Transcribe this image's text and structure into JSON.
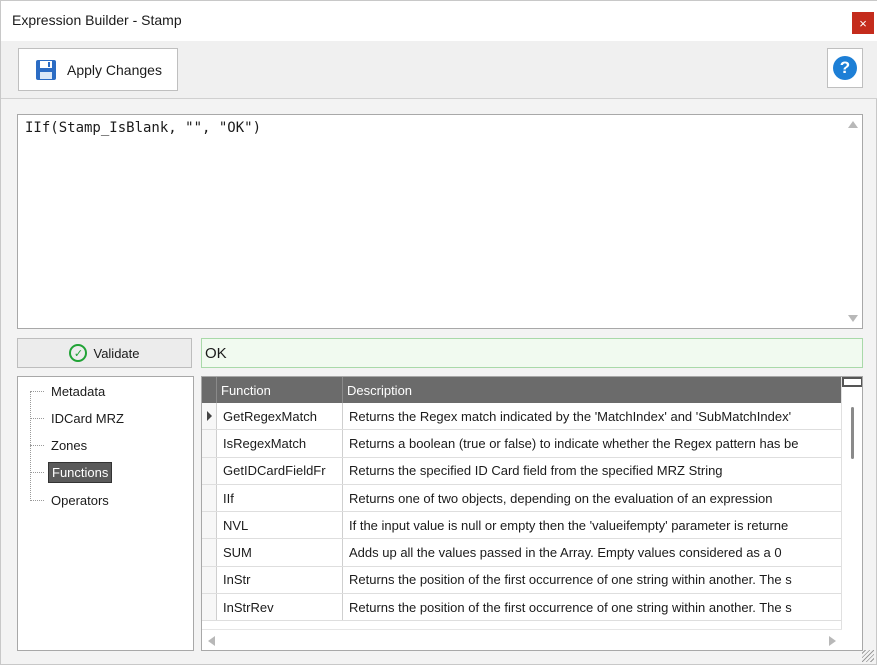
{
  "window": {
    "title": "Expression Builder - Stamp",
    "close_glyph": "×"
  },
  "toolbar": {
    "apply_label": "Apply Changes",
    "apply_icon": "save-icon",
    "help_glyph": "?"
  },
  "editor": {
    "expression": "IIf(Stamp_IsBlank, \"\", \"OK\")"
  },
  "validate": {
    "label": "Validate",
    "icon": "check-circle-icon",
    "result": "OK"
  },
  "tree": {
    "items": [
      "Metadata",
      "IDCard MRZ",
      "Zones",
      "Functions",
      "Operators"
    ],
    "selected": "Functions"
  },
  "grid": {
    "headers": {
      "function": "Function",
      "description": "Description"
    },
    "rows": [
      {
        "function": "GetRegexMatch",
        "description": "Returns the Regex match indicated by the 'MatchIndex' and 'SubMatchIndex'"
      },
      {
        "function": "IsRegexMatch",
        "description": "Returns a boolean (true or false) to indicate whether the Regex pattern has be"
      },
      {
        "function": "GetIDCardFieldFr",
        "description": "Returns the specified ID Card field from the specified MRZ String"
      },
      {
        "function": "IIf",
        "description": "Returns one of two objects, depending on the evaluation of an expression"
      },
      {
        "function": "NVL",
        "description": "If the input value is null or empty then the 'valueifempty' parameter is returne"
      },
      {
        "function": "SUM",
        "description": "Adds up all the values passed in the Array. Empty values considered as a 0"
      },
      {
        "function": "InStr",
        "description": "Returns the position of the first occurrence of one string within another. The s"
      },
      {
        "function": "InStrRev",
        "description": "Returns the position of the first occurrence of one string within another. The s"
      }
    ]
  },
  "colors": {
    "header_bg": "#6b6b6b",
    "close_bg": "#c42b1c",
    "help_blue": "#1d7fd6",
    "valid_green": "#21a336",
    "result_bg": "#f1faf0"
  }
}
